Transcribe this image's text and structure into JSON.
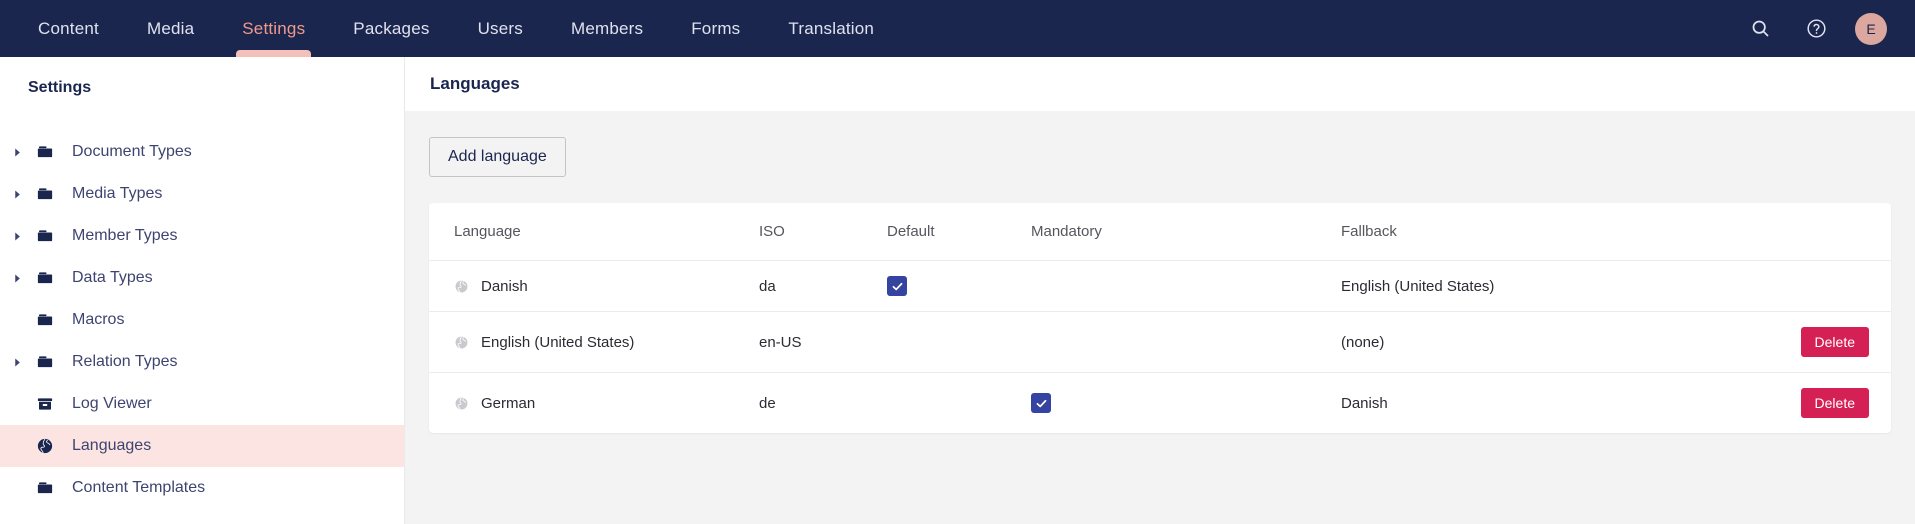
{
  "topnav": {
    "background_color": "#1b264f",
    "active_color": "#f09a8a",
    "items": [
      {
        "label": "Content",
        "active": false
      },
      {
        "label": "Media",
        "active": false
      },
      {
        "label": "Settings",
        "active": true
      },
      {
        "label": "Packages",
        "active": false
      },
      {
        "label": "Users",
        "active": false
      },
      {
        "label": "Members",
        "active": false
      },
      {
        "label": "Forms",
        "active": false
      },
      {
        "label": "Translation",
        "active": false
      }
    ],
    "search_icon": "search-icon",
    "help_icon": "help-circle-icon",
    "avatar_initial": "E",
    "avatar_color": "#dba79e"
  },
  "sidebar": {
    "title": "Settings",
    "selected_color": "#fbe4e1",
    "items": [
      {
        "label": "Document Types",
        "icon": "folder-icon",
        "expandable": true,
        "selected": false
      },
      {
        "label": "Media Types",
        "icon": "folder-icon",
        "expandable": true,
        "selected": false
      },
      {
        "label": "Member Types",
        "icon": "folder-icon",
        "expandable": true,
        "selected": false
      },
      {
        "label": "Data Types",
        "icon": "folder-icon",
        "expandable": true,
        "selected": false
      },
      {
        "label": "Macros",
        "icon": "folder-icon",
        "expandable": false,
        "selected": false
      },
      {
        "label": "Relation Types",
        "icon": "folder-icon",
        "expandable": true,
        "selected": false
      },
      {
        "label": "Log Viewer",
        "icon": "archive-box-icon",
        "expandable": false,
        "selected": false
      },
      {
        "label": "Languages",
        "icon": "globe-icon",
        "expandable": false,
        "selected": true
      },
      {
        "label": "Content Templates",
        "icon": "folder-icon",
        "expandable": false,
        "selected": false
      }
    ]
  },
  "main": {
    "title": "Languages",
    "add_button_label": "Add language",
    "table": {
      "columns": [
        "Language",
        "ISO",
        "Default",
        "Mandatory",
        "Fallback",
        ""
      ],
      "checkbox_color": "#3544a0",
      "delete_color": "#d42054",
      "rows": [
        {
          "language": "Danish",
          "iso": "da",
          "default": true,
          "mandatory": false,
          "fallback": "English (United States)",
          "delete_label": "",
          "deletable": false
        },
        {
          "language": "English (United States)",
          "iso": "en-US",
          "default": false,
          "mandatory": false,
          "fallback": "(none)",
          "delete_label": "Delete",
          "deletable": true
        },
        {
          "language": "German",
          "iso": "de",
          "default": false,
          "mandatory": true,
          "fallback": "Danish",
          "delete_label": "Delete",
          "deletable": true
        }
      ]
    }
  }
}
